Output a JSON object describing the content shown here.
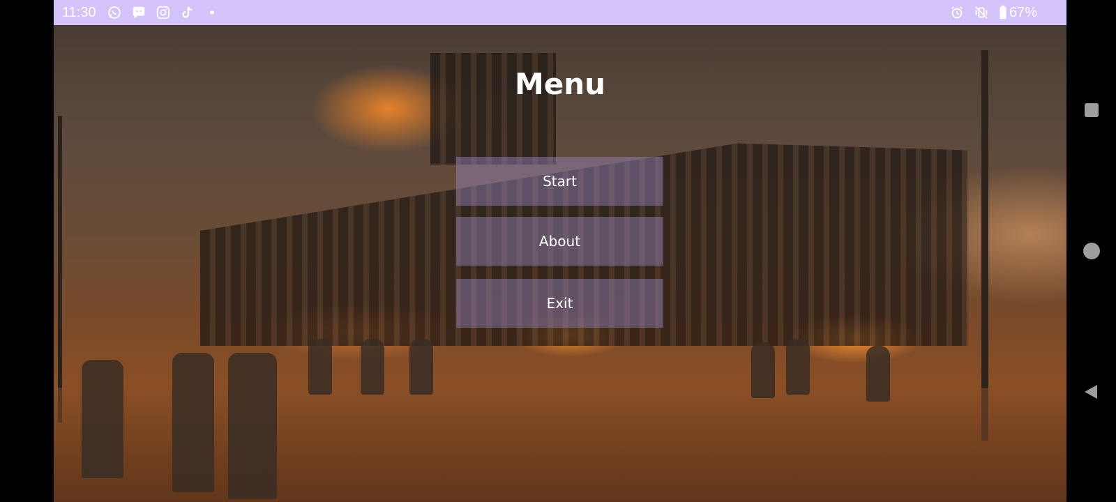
{
  "status_bar": {
    "time": "11:30",
    "left_icons": [
      "whatsapp-icon",
      "messages-icon",
      "instagram-icon",
      "tiktok-icon",
      "dot-icon"
    ],
    "right_icons": [
      "alarm-icon",
      "vibrate-off-icon",
      "battery-icon"
    ],
    "battery": "67%",
    "background": "#d4c2fb"
  },
  "menu": {
    "title": "Menu",
    "buttons": {
      "start": "Start",
      "about": "About",
      "exit": "Exit"
    },
    "button_color": "rgba(150,135,190,0.45)"
  },
  "nav_bar": {
    "icons": [
      "recent-apps-icon",
      "home-icon",
      "back-icon"
    ]
  }
}
